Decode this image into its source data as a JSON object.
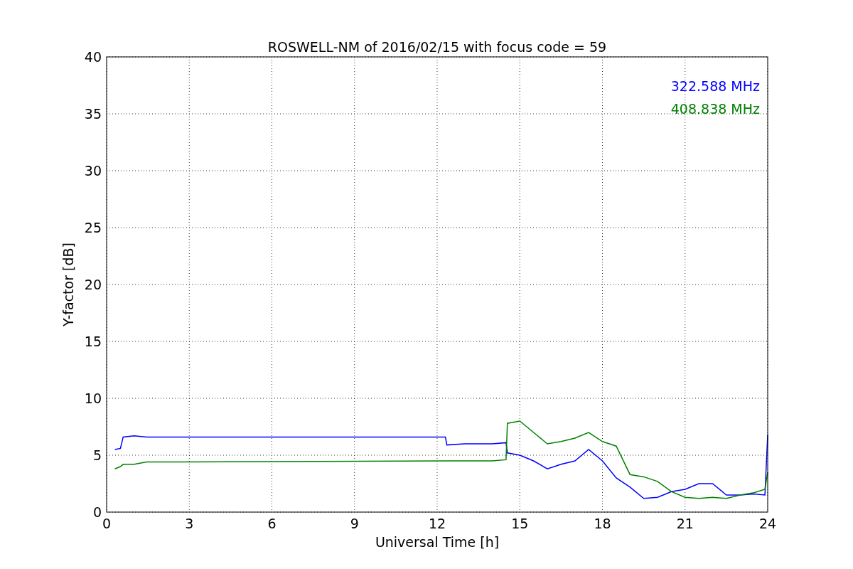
{
  "chart_data": {
    "type": "line",
    "title": "ROSWELL-NM of 2016/02/15 with focus code = 59",
    "xlabel": "Universal Time [h]",
    "ylabel": "Y-factor [dB]",
    "x": [
      0.3,
      0.5,
      0.6,
      1.0,
      1.45,
      12.3,
      12.35,
      13,
      14,
      14.5,
      14.55,
      15,
      15.5,
      16,
      16.5,
      17,
      17.5,
      18,
      18.5,
      19,
      19.5,
      20,
      20.5,
      21,
      21.5,
      22,
      22.5,
      23,
      23.5,
      23.9,
      24
    ],
    "series": [
      {
        "name": "322.588 MHz",
        "color": "#0000ff",
        "values": [
          5.5,
          5.6,
          6.6,
          6.7,
          6.6,
          6.6,
          5.9,
          6.0,
          6.0,
          6.1,
          5.2,
          5.0,
          4.5,
          3.8,
          4.2,
          4.5,
          5.5,
          4.5,
          3.0,
          2.2,
          1.2,
          1.3,
          1.8,
          2.0,
          2.5,
          2.5,
          1.5,
          1.5,
          1.6,
          1.5,
          6.8
        ]
      },
      {
        "name": "408.838 MHz",
        "color": "#008000",
        "values": [
          3.8,
          4.0,
          4.2,
          4.2,
          4.4,
          4.5,
          4.5,
          4.5,
          4.5,
          4.6,
          7.8,
          8.0,
          7.0,
          6.0,
          6.2,
          6.5,
          7.0,
          6.2,
          5.8,
          3.3,
          3.1,
          2.7,
          1.8,
          1.3,
          1.2,
          1.3,
          1.2,
          1.5,
          1.7,
          2.0,
          3.5
        ]
      }
    ],
    "xlim": [
      0,
      24
    ],
    "ylim": [
      0,
      40
    ],
    "xticks": [
      0,
      3,
      6,
      9,
      12,
      15,
      18,
      21,
      24
    ],
    "yticks": [
      0,
      5,
      10,
      15,
      20,
      25,
      30,
      35,
      40
    ],
    "grid": true
  }
}
